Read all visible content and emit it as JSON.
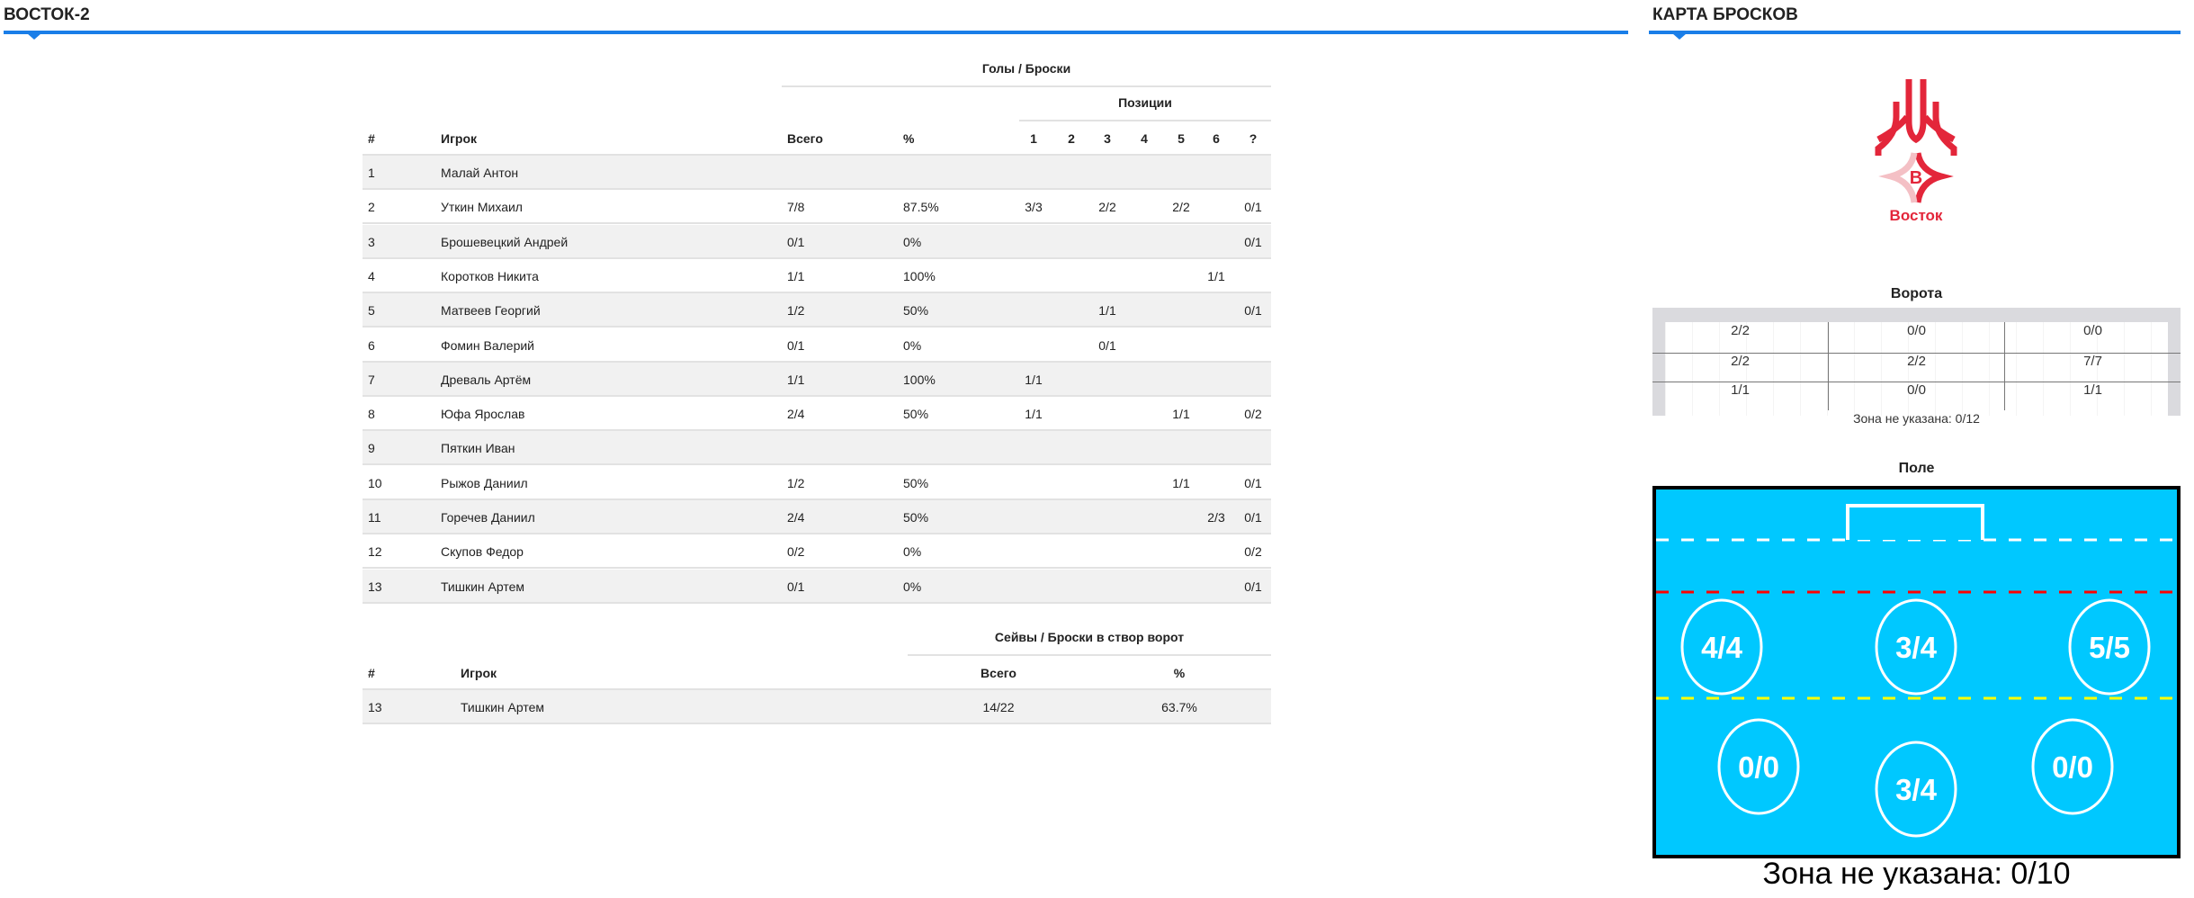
{
  "left_section": {
    "title": "ВОСТОК-2"
  },
  "right_section": {
    "title": "КАРТА БРОСКОВ"
  },
  "goals_table": {
    "group_header": "Голы / Броски",
    "positions_header": "Позиции",
    "columns": {
      "num": "#",
      "player": "Игрок",
      "total": "Всего",
      "pct": "%",
      "positions": [
        "1",
        "2",
        "3",
        "4",
        "5",
        "6",
        "?"
      ]
    },
    "rows": [
      {
        "num": "1",
        "player": "Малай Антон",
        "total": "",
        "pct": "",
        "pos": [
          "",
          "",
          "",
          "",
          "",
          "",
          ""
        ]
      },
      {
        "num": "2",
        "player": "Уткин Михаил",
        "total": "7/8",
        "pct": "87.5%",
        "pos": [
          "3/3",
          "",
          "2/2",
          "",
          "2/2",
          "",
          "0/1"
        ]
      },
      {
        "num": "3",
        "player": "Брошевецкий Андрей",
        "total": "0/1",
        "pct": "0%",
        "pos": [
          "",
          "",
          "",
          "",
          "",
          "",
          "0/1"
        ]
      },
      {
        "num": "4",
        "player": "Коротков Никита",
        "total": "1/1",
        "pct": "100%",
        "pos": [
          "",
          "",
          "",
          "",
          "",
          "1/1",
          ""
        ]
      },
      {
        "num": "5",
        "player": "Матвеев Георгий",
        "total": "1/2",
        "pct": "50%",
        "pos": [
          "",
          "",
          "1/1",
          "",
          "",
          "",
          "0/1"
        ]
      },
      {
        "num": "6",
        "player": "Фомин Валерий",
        "total": "0/1",
        "pct": "0%",
        "pos": [
          "",
          "",
          "0/1",
          "",
          "",
          "",
          ""
        ]
      },
      {
        "num": "7",
        "player": "Древаль Артём",
        "total": "1/1",
        "pct": "100%",
        "pos": [
          "1/1",
          "",
          "",
          "",
          "",
          "",
          ""
        ]
      },
      {
        "num": "8",
        "player": "Юфа Ярослав",
        "total": "2/4",
        "pct": "50%",
        "pos": [
          "1/1",
          "",
          "",
          "",
          "1/1",
          "",
          "0/2"
        ]
      },
      {
        "num": "9",
        "player": "Пяткин Иван",
        "total": "",
        "pct": "",
        "pos": [
          "",
          "",
          "",
          "",
          "",
          "",
          ""
        ]
      },
      {
        "num": "10",
        "player": "Рыжов Даниил",
        "total": "1/2",
        "pct": "50%",
        "pos": [
          "",
          "",
          "",
          "",
          "1/1",
          "",
          "0/1"
        ]
      },
      {
        "num": "11",
        "player": "Горечев Даниил",
        "total": "2/4",
        "pct": "50%",
        "pos": [
          "",
          "",
          "",
          "",
          "",
          "2/3",
          "0/1"
        ]
      },
      {
        "num": "12",
        "player": "Скупов Федор",
        "total": "0/2",
        "pct": "0%",
        "pos": [
          "",
          "",
          "",
          "",
          "",
          "",
          "0/2"
        ]
      },
      {
        "num": "13",
        "player": "Тишкин Артем",
        "total": "0/1",
        "pct": "0%",
        "pos": [
          "",
          "",
          "",
          "",
          "",
          "",
          "0/1"
        ]
      }
    ]
  },
  "saves_table": {
    "group_header": "Сейвы / Броски в створ ворот",
    "columns": {
      "num": "#",
      "player": "Игрок",
      "total": "Всего",
      "pct": "%"
    },
    "rows": [
      {
        "num": "13",
        "player": "Тишкин Артем",
        "total": "14/22",
        "pct": "63.7%"
      }
    ]
  },
  "logo": {
    "letter": "В",
    "text": "Восток",
    "color": "#e3263a"
  },
  "goal_map": {
    "title": "Ворота",
    "cells": [
      [
        "2/2",
        "0/0",
        "0/0"
      ],
      [
        "2/2",
        "2/2",
        "7/7"
      ],
      [
        "1/1",
        "0/0",
        "1/1"
      ]
    ],
    "unspecified": "Зона не указана: 0/12"
  },
  "field_map": {
    "title": "Поле",
    "zones": [
      "4/4",
      "3/4",
      "5/5",
      "0/0",
      "3/4",
      "0/0"
    ],
    "unspecified": "Зона не указана: 0/10",
    "colors": {
      "field": "#00c8ff",
      "goal_line": "#ffffff",
      "red_line": "#ff0000",
      "yellow_line": "#ffff00"
    }
  }
}
